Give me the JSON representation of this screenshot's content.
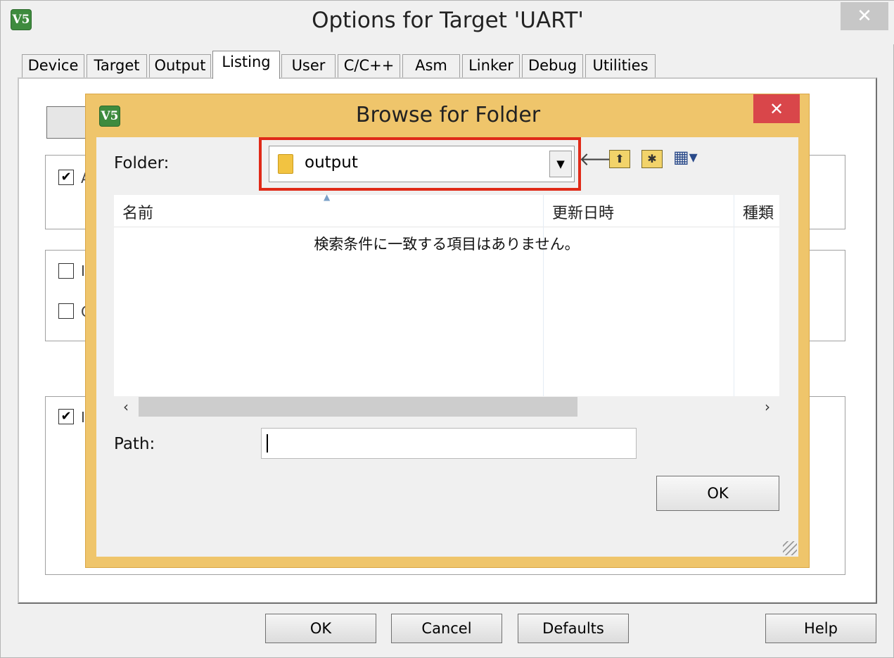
{
  "window": {
    "title": "Options for Target 'UART'",
    "app_icon": "V5",
    "close_glyph": "✕"
  },
  "tabs": [
    "Device",
    "Target",
    "Output",
    "Listing",
    "User",
    "C/C++",
    "Asm",
    "Linker",
    "Debug",
    "Utilities"
  ],
  "active_tab": "Listing",
  "background_checkboxes": [
    {
      "checked": true,
      "partial_label": "A"
    },
    {
      "checked": false,
      "partial_label": "I"
    },
    {
      "checked": false,
      "partial_label": "C"
    },
    {
      "checked": true,
      "partial_label": "I"
    }
  ],
  "dialog": {
    "title": "Browse for Folder",
    "app_icon": "V5",
    "close_glyph": "✕",
    "folder_label": "Folder:",
    "folder_value": "output",
    "dropdown_glyph": "▼",
    "toolbar": {
      "back": "🡐",
      "up": "⬆",
      "new_folder": "✱",
      "view": "▦▾"
    },
    "columns": [
      "名前",
      "更新日時",
      "種類"
    ],
    "sort_indicator": "▲",
    "empty_message": "検索条件に一致する項目はありません。",
    "scroll_left": "‹",
    "scroll_right": "›",
    "path_label": "Path:",
    "path_value": "",
    "ok_label": "OK"
  },
  "footer_buttons": {
    "ok": "OK",
    "cancel": "Cancel",
    "defaults": "Defaults",
    "help": "Help"
  },
  "colors": {
    "dialog_frame": "#efc56b",
    "highlight": "#e02a18",
    "close_red": "#d9464a"
  }
}
